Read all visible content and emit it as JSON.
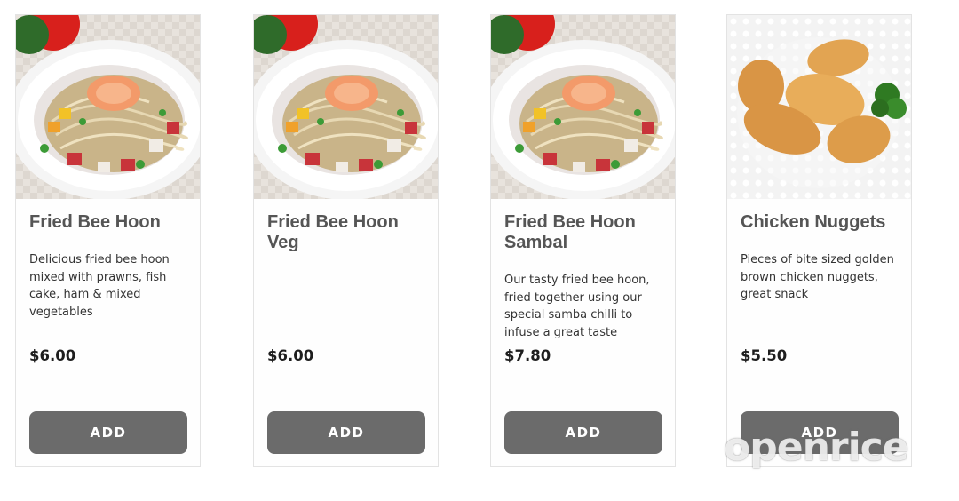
{
  "products": [
    {
      "title": "Fried Bee Hoon",
      "description": "Delicious fried bee hoon mixed with prawns, fish cake, ham & mixed vegetables",
      "price": "$6.00",
      "button_label": "ADD",
      "image_icon": "fried-bee-hoon-photo"
    },
    {
      "title": "Fried Bee Hoon Veg",
      "description": "",
      "price": "$6.00",
      "button_label": "ADD",
      "image_icon": "fried-bee-hoon-photo"
    },
    {
      "title": "Fried Bee Hoon Sambal",
      "description": "Our tasty fried bee hoon, fried together using our special samba chilli to infuse a great taste",
      "price": "$7.80",
      "button_label": "ADD",
      "image_icon": "fried-bee-hoon-photo"
    },
    {
      "title": "Chicken Nuggets",
      "description": "Pieces of bite sized golden brown chicken nuggets, great snack",
      "price": "$5.50",
      "button_label": "ADD",
      "image_icon": "chicken-nuggets-photo"
    }
  ],
  "watermark": "openrice",
  "colors": {
    "button_bg": "#6b6b6b",
    "title_text": "#555555",
    "card_border": "#e3e3e3"
  }
}
